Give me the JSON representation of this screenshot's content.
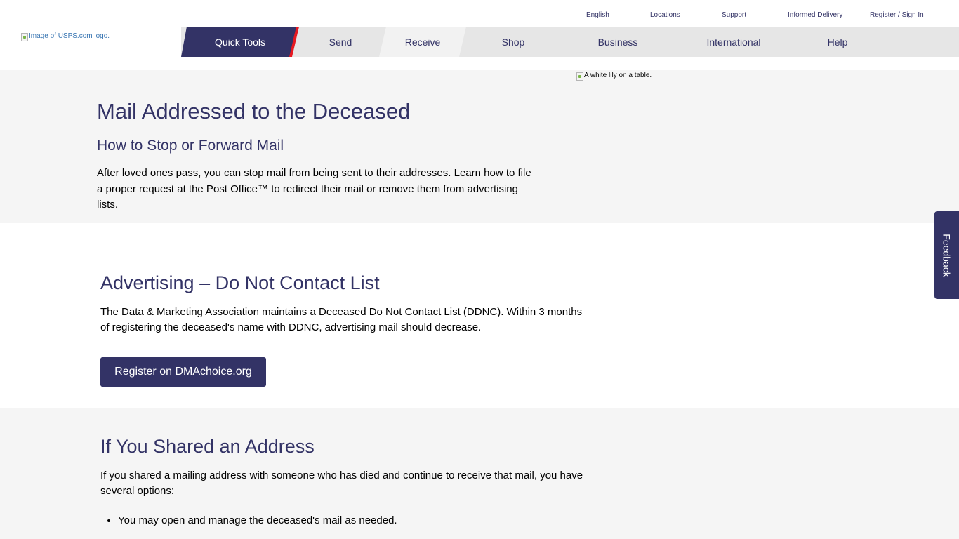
{
  "utility_nav": [
    {
      "label": "English"
    },
    {
      "label": "Locations"
    },
    {
      "label": "Support"
    },
    {
      "label": "Informed Delivery"
    },
    {
      "label": "Register / Sign In"
    }
  ],
  "logo": {
    "alt_text": "Image of USPS.com logo."
  },
  "main_nav": [
    {
      "label": "Quick Tools"
    },
    {
      "label": "Send"
    },
    {
      "label": "Receive"
    },
    {
      "label": "Shop"
    },
    {
      "label": "Business"
    },
    {
      "label": "International"
    },
    {
      "label": "Help"
    }
  ],
  "hero": {
    "title": "Mail Addressed to the Deceased",
    "subtitle": "How to Stop or Forward Mail",
    "text": "After loved ones pass, you can stop mail from being sent to their addresses. Learn how to file a proper request at the Post Office™ to redirect their mail or remove them from advertising lists.",
    "image_alt": "A white lily on a table."
  },
  "advertising": {
    "heading": "Advertising – Do Not Contact List",
    "text": "The Data & Marketing Association maintains a Deceased Do Not Contact List (DDNC). Within 3 months of registering the deceased's name with DDNC, advertising mail should decrease.",
    "button_label": "Register on DMAchoice.org"
  },
  "shared_address": {
    "heading": "If You Shared an Address",
    "text": "If you shared a mailing address with someone who has died and continue to receive that mail, you have several options:",
    "bullets": [
      "You may open and manage the deceased's mail as needed."
    ]
  },
  "feedback": {
    "label": "Feedback"
  },
  "colors": {
    "brand_navy": "#333366",
    "accent_red": "#e71921",
    "nav_grey": "#e6e6e6",
    "section_grey": "#f5f5f5",
    "link_blue": "#3573b1"
  }
}
